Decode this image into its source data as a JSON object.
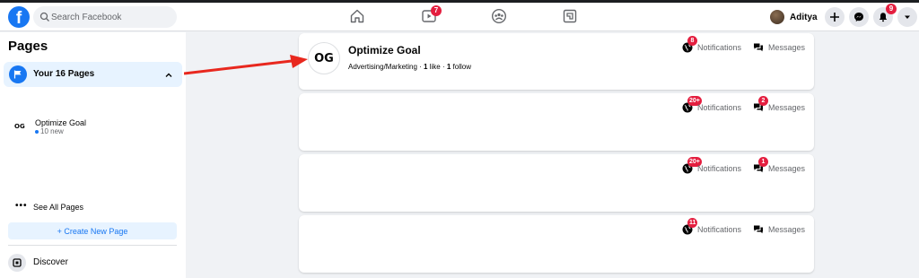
{
  "header": {
    "logo": "f",
    "search_placeholder": "Search Facebook",
    "nav": [
      {
        "name": "home",
        "badge": ""
      },
      {
        "name": "watch",
        "badge": "7"
      },
      {
        "name": "groups",
        "badge": ""
      },
      {
        "name": "gaming",
        "badge": ""
      }
    ],
    "watch_badge": "7",
    "profile_name": "Aditya",
    "notifications_badge": "9"
  },
  "sidebar": {
    "title": "Pages",
    "your_pages_label": "Your 16 Pages",
    "page_item": {
      "logo": "OG",
      "name": "Optimize Goal",
      "sub": "10 new"
    },
    "see_all_dots": "•••",
    "see_all_label": "See All Pages",
    "create_label": "+ Create New Page",
    "discover_label": "Discover"
  },
  "cards": [
    {
      "avatar": "OG",
      "name": "Optimize Goal",
      "category": "Advertising/Marketing",
      "likes": "1",
      "likes_label": "like",
      "follows": "1",
      "follows_label": "follow",
      "notif_badge": "8",
      "msg_badge": ""
    },
    {
      "notif_badge": "20+",
      "msg_badge": "2"
    },
    {
      "notif_badge": "20+",
      "msg_badge": "1"
    },
    {
      "notif_badge": "11",
      "msg_badge": ""
    }
  ],
  "labels": {
    "notifications": "Notifications",
    "messages": "Messages"
  },
  "colors": {
    "brand": "#1877f2",
    "badge": "#e41e3f",
    "arrow": "#e8281e",
    "selected_bg": "#e7f3ff"
  }
}
